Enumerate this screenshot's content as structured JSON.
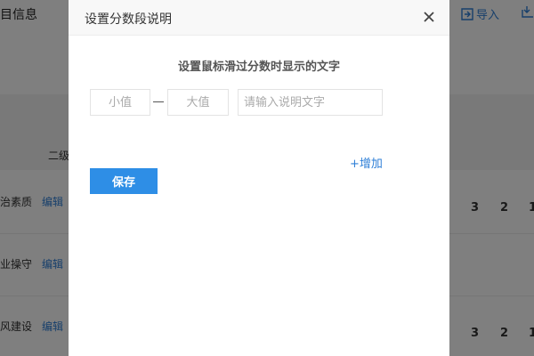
{
  "background": {
    "title": "目信息",
    "import_label": "导入",
    "column_header": "二级",
    "edit_label": "编辑",
    "rows": [
      {
        "name": "治素质",
        "scores": [
          "3",
          "2",
          "1"
        ]
      },
      {
        "name": "业操守",
        "scores": []
      },
      {
        "name": "风建设",
        "scores": [
          "3",
          "2",
          "1"
        ]
      }
    ]
  },
  "modal": {
    "title": "设置分数段说明",
    "subtitle": "设置鼠标滑过分数时显示的文字",
    "min_placeholder": "小值",
    "max_placeholder": "大值",
    "desc_placeholder": "请输入说明文字",
    "add_label": "+增加",
    "save_label": "保存"
  },
  "colors": {
    "accent": "#2e8ee6",
    "link": "#2e7fd7"
  }
}
